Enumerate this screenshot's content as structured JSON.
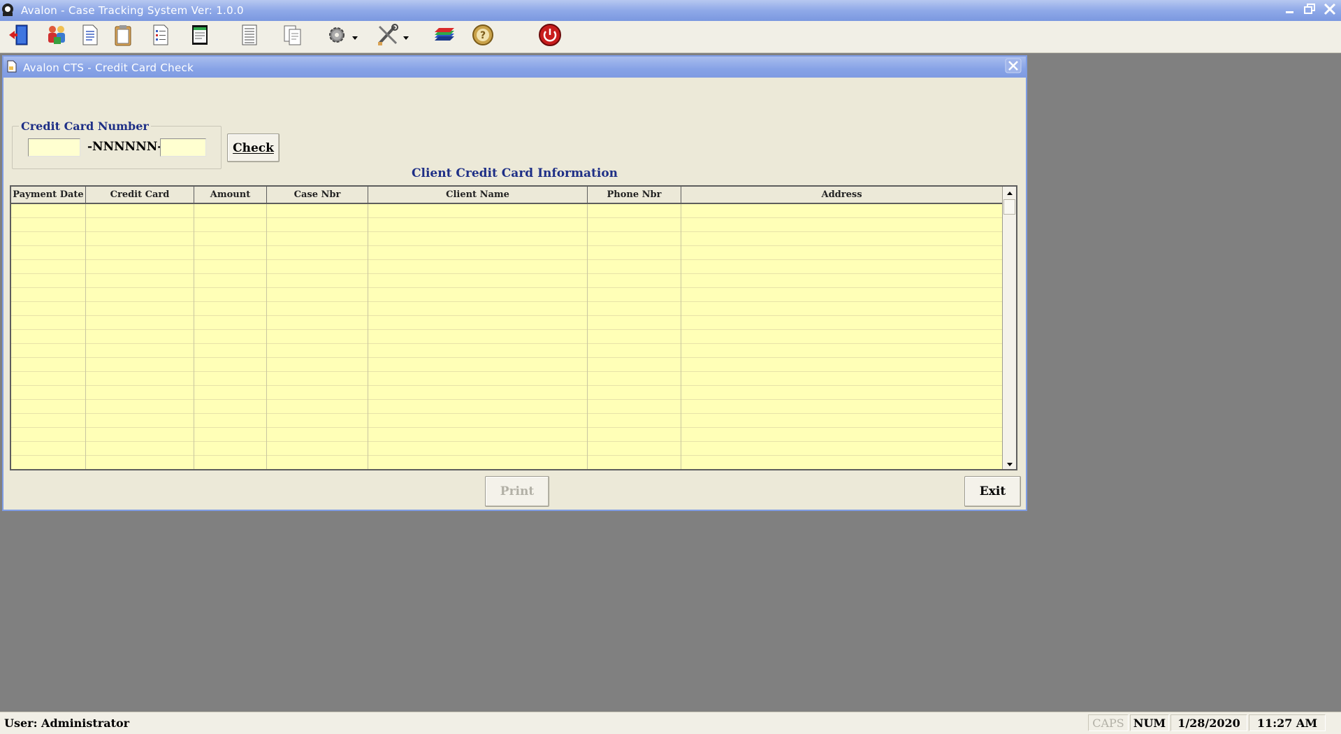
{
  "app": {
    "title": "Avalon - Case Tracking System   Ver: 1.0.0",
    "icons": {
      "app": "avalon-app-icon",
      "minimize": "minimize-icon",
      "restore": "restore-icon",
      "close": "close-icon"
    }
  },
  "toolbar": {
    "buttons": [
      {
        "name": "exit-door-icon"
      },
      {
        "name": "clients-icon"
      },
      {
        "name": "document-icon"
      },
      {
        "name": "clipboard-icon"
      },
      {
        "name": "checklist-icon"
      },
      {
        "name": "notepad-icon"
      },
      {
        "name": "report-icon"
      },
      {
        "name": "copy-documents-icon"
      },
      {
        "name": "settings-gear-icon"
      },
      {
        "name": "tools-icon"
      },
      {
        "name": "layers-icon"
      },
      {
        "name": "help-icon"
      },
      {
        "name": "power-icon"
      }
    ]
  },
  "child_window": {
    "title": "Avalon CTS - Credit Card Check",
    "card_group": {
      "legend": "Credit Card Number",
      "first_value": "",
      "mask": "-NNNNNN-",
      "last_value": ""
    },
    "check_label": "Check",
    "section_title": "Client Credit Card Information",
    "columns": [
      "Payment Date",
      "Credit Card",
      "Amount",
      "Case Nbr",
      "Client Name",
      "Phone Nbr",
      "Address"
    ],
    "rows": [],
    "print_label": "Print",
    "exit_label": "Exit"
  },
  "status": {
    "user": "User: Administrator",
    "caps": "CAPS",
    "num": "NUM",
    "date": "1/28/2020",
    "time": "11:27 AM"
  }
}
